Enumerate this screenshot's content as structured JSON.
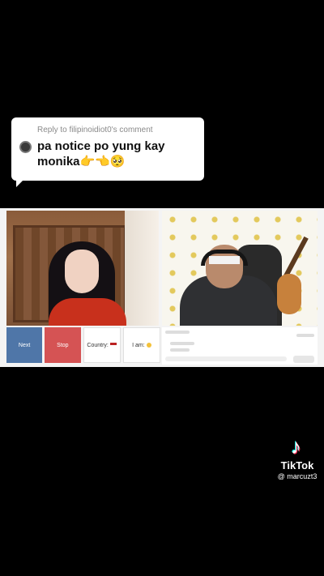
{
  "reply": {
    "header": "Reply to filipinoidiot0's comment",
    "text": "pa notice po yung kay monika👉👈🥺"
  },
  "controls": {
    "next_label": "Next",
    "stop_label": "Stop",
    "country_label": "Country:",
    "iam_label": "I am:"
  },
  "watermark": {
    "logo_glyph": "♪",
    "brand": "TikTok",
    "username": "@ marcuzt3"
  },
  "colors": {
    "next": "#4f76a8",
    "stop": "#d55354",
    "tiktok_cyan": "#25f4ee",
    "tiktok_red": "#fe2c55"
  }
}
